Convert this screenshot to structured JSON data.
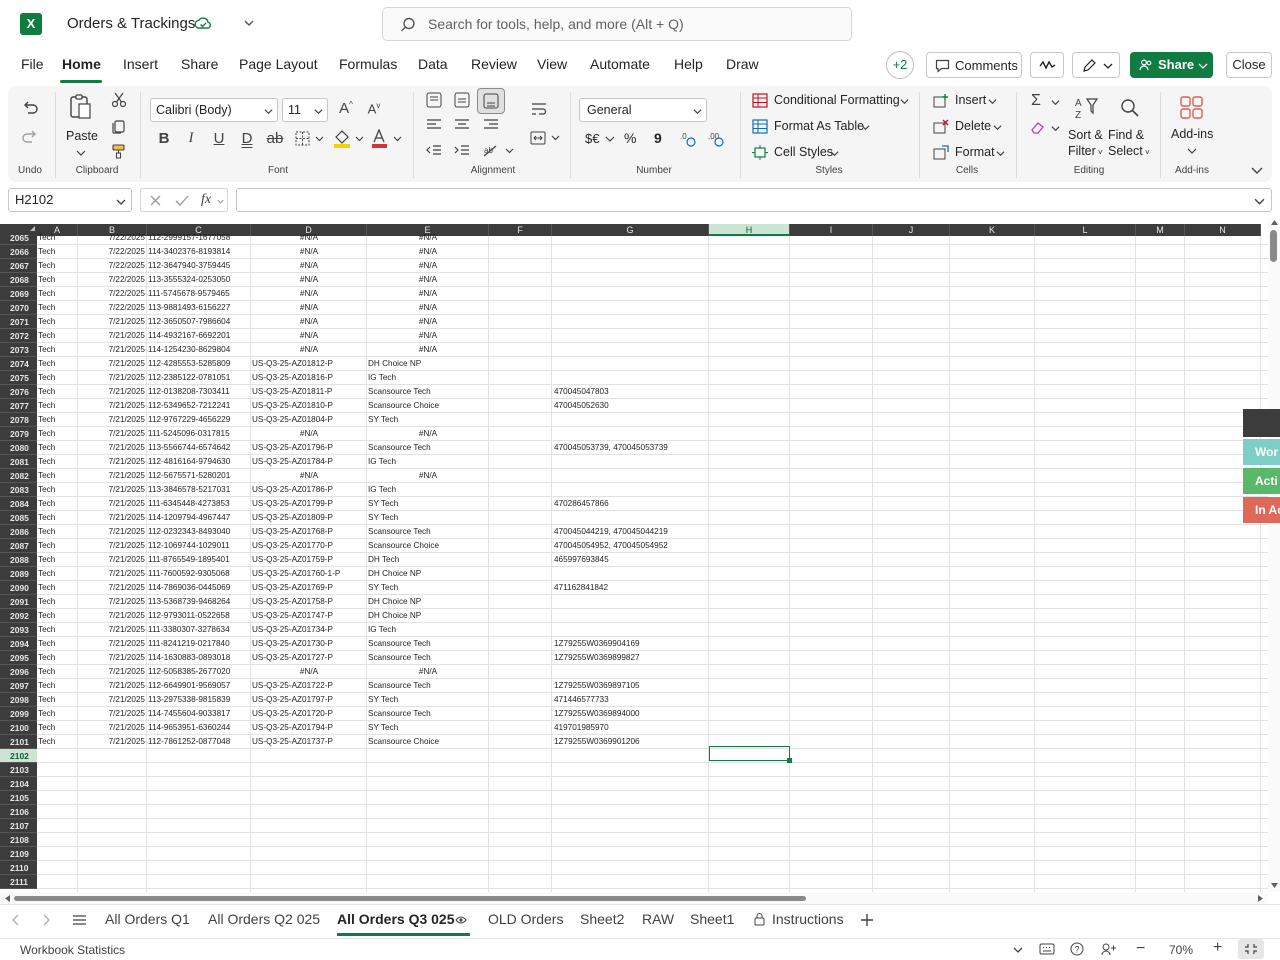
{
  "titlebar": {
    "app_icon": "X",
    "doc_title": "Orders & Trackings",
    "search_placeholder": "Search for tools, help, and more (Alt + Q)"
  },
  "menu": {
    "items": [
      "File",
      "Home",
      "Insert",
      "Share",
      "Page Layout",
      "Formulas",
      "Data",
      "Review",
      "View",
      "Automate",
      "Help",
      "Draw"
    ],
    "active": "Home",
    "collab_count": "+2",
    "comments": "Comments",
    "share": "Share",
    "close": "Close"
  },
  "ribbon": {
    "undo_group": "Undo",
    "clipboard": {
      "paste": "Paste",
      "label": "Clipboard"
    },
    "font": {
      "name": "Calibri (Body)",
      "size": "11",
      "label": "Font"
    },
    "alignment_label": "Alignment",
    "number": {
      "format": "General",
      "currency": "$€",
      "percent": "%",
      "comma": "9",
      "label": "Number"
    },
    "styles": {
      "conditional": "Conditional Formatting",
      "table": "Format As Table",
      "cell": "Cell Styles",
      "label": "Styles"
    },
    "cells": {
      "insert": "Insert",
      "delete": "Delete",
      "format": "Format",
      "label": "Cells"
    },
    "editing": {
      "sort1": "Sort &",
      "sort2": "Filter",
      "find1": "Find &",
      "find2": "Select",
      "label": "Editing"
    },
    "addins": {
      "btn": "Add-ins",
      "label": "Add-ins"
    }
  },
  "formula_bar": {
    "name_box": "H2102",
    "formula": ""
  },
  "grid": {
    "columns": [
      "A",
      "B",
      "C",
      "D",
      "E",
      "F",
      "G",
      "H",
      "I",
      "J",
      "K",
      "L",
      "M",
      "N"
    ],
    "selected_column": "H",
    "selected_row": "2102",
    "partial_row": {
      "num": "2065",
      "a": "Tech",
      "b": "7/22/2025",
      "c": "112-2999157-1677058",
      "d": "#N/A",
      "e": "#N/A"
    },
    "rows": [
      {
        "num": "2066",
        "a": "Tech",
        "b": "7/22/2025",
        "c": "114-3402376-8193814",
        "d": "#N/A",
        "e": "#N/A",
        "g": ""
      },
      {
        "num": "2067",
        "a": "Tech",
        "b": "7/22/2025",
        "c": "112-3647940-3759445",
        "d": "#N/A",
        "e": "#N/A",
        "g": ""
      },
      {
        "num": "2068",
        "a": "Tech",
        "b": "7/22/2025",
        "c": "113-3555324-0253050",
        "d": "#N/A",
        "e": "#N/A",
        "g": ""
      },
      {
        "num": "2069",
        "a": "Tech",
        "b": "7/22/2025",
        "c": "111-5745678-9579465",
        "d": "#N/A",
        "e": "#N/A",
        "g": ""
      },
      {
        "num": "2070",
        "a": "Tech",
        "b": "7/22/2025",
        "c": "113-9881493-6156227",
        "d": "#N/A",
        "e": "#N/A",
        "g": ""
      },
      {
        "num": "2071",
        "a": "Tech",
        "b": "7/21/2025",
        "c": "112-3650507-7986604",
        "d": "#N/A",
        "e": "#N/A",
        "g": ""
      },
      {
        "num": "2072",
        "a": "Tech",
        "b": "7/21/2025",
        "c": "114-4932167-6692201",
        "d": "#N/A",
        "e": "#N/A",
        "g": ""
      },
      {
        "num": "2073",
        "a": "Tech",
        "b": "7/21/2025",
        "c": "114-1254230-8629804",
        "d": "#N/A",
        "e": "#N/A",
        "g": ""
      },
      {
        "num": "2074",
        "a": "Tech",
        "b": "7/21/2025",
        "c": "112-4285553-5285809",
        "d": "US-Q3-25-AZ01812-P",
        "e": "DH Choice NP",
        "g": ""
      },
      {
        "num": "2075",
        "a": "Tech",
        "b": "7/21/2025",
        "c": "112-2385122-0781051",
        "d": "US-Q3-25-AZ01816-P",
        "e": "IG Tech",
        "g": ""
      },
      {
        "num": "2076",
        "a": "Tech",
        "b": "7/21/2025",
        "c": "112-0138208-7303411",
        "d": "US-Q3-25-AZ01811-P",
        "e": "Scansource Tech",
        "g": "470045047803"
      },
      {
        "num": "2077",
        "a": "Tech",
        "b": "7/21/2025",
        "c": "112-5349652-7212241",
        "d": "US-Q3-25-AZ01810-P",
        "e": "Scansource Choice",
        "g": "470045052630"
      },
      {
        "num": "2078",
        "a": "Tech",
        "b": "7/21/2025",
        "c": "112-9767229-4656229",
        "d": "US-Q3-25-AZ01804-P",
        "e": "SY Tech",
        "g": ""
      },
      {
        "num": "2079",
        "a": "Tech",
        "b": "7/21/2025",
        "c": "111-5245096-0317815",
        "d": "#N/A",
        "e": "#N/A",
        "g": ""
      },
      {
        "num": "2080",
        "a": "Tech",
        "b": "7/21/2025",
        "c": "113-5566744-6574642",
        "d": "US-Q3-25-AZ01796-P",
        "e": "Scansource Tech",
        "g": "470045053739, 470045053739"
      },
      {
        "num": "2081",
        "a": "Tech",
        "b": "7/21/2025",
        "c": "112-4816164-9794630",
        "d": "US-Q3-25-AZ01784-P",
        "e": "IG Tech",
        "g": ""
      },
      {
        "num": "2082",
        "a": "Tech",
        "b": "7/21/2025",
        "c": "112-5675571-5280201",
        "d": "#N/A",
        "e": "#N/A",
        "g": ""
      },
      {
        "num": "2083",
        "a": "Tech",
        "b": "7/21/2025",
        "c": "113-3846578-5217031",
        "d": "US-Q3-25-AZ01786-P",
        "e": "IG Tech",
        "g": ""
      },
      {
        "num": "2084",
        "a": "Tech",
        "b": "7/21/2025",
        "c": "111-6345448-4273853",
        "d": "US-Q3-25-AZ01799-P",
        "e": "SY Tech",
        "g": "470286457866"
      },
      {
        "num": "2085",
        "a": "Tech",
        "b": "7/21/2025",
        "c": "114-1209794-4967447",
        "d": "US-Q3-25-AZ01809-P",
        "e": "SY Tech",
        "g": ""
      },
      {
        "num": "2086",
        "a": "Tech",
        "b": "7/21/2025",
        "c": "112-0232343-8493040",
        "d": "US-Q3-25-AZ01768-P",
        "e": "Scansource Tech",
        "g": "470045044219, 470045044219"
      },
      {
        "num": "2087",
        "a": "Tech",
        "b": "7/21/2025",
        "c": "112-1069744-1029011",
        "d": "US-Q3-25-AZ01770-P",
        "e": "Scansource Choice",
        "g": "470045054952, 470045054952"
      },
      {
        "num": "2088",
        "a": "Tech",
        "b": "7/21/2025",
        "c": "111-8765549-1895401",
        "d": "US-Q3-25-AZ01759-P",
        "e": "DH Tech",
        "g": "465997693845"
      },
      {
        "num": "2089",
        "a": "Tech",
        "b": "7/21/2025",
        "c": "111-7600592-9305068",
        "d": "US-Q3-25-AZ01760-1-P",
        "e": "DH Choice NP",
        "g": ""
      },
      {
        "num": "2090",
        "a": "Tech",
        "b": "7/21/2025",
        "c": "114-7869036-0445069",
        "d": "US-Q3-25-AZ01769-P",
        "e": "SY Tech",
        "g": "471162841842"
      },
      {
        "num": "2091",
        "a": "Tech",
        "b": "7/21/2025",
        "c": "113-5368739-9468264",
        "d": "US-Q3-25-AZ01758-P",
        "e": "DH Choice NP",
        "g": ""
      },
      {
        "num": "2092",
        "a": "Tech",
        "b": "7/21/2025",
        "c": "112-9793011-0522658",
        "d": "US-Q3-25-AZ01747-P",
        "e": "DH Choice NP",
        "g": ""
      },
      {
        "num": "2093",
        "a": "Tech",
        "b": "7/21/2025",
        "c": "111-3380307-3278634",
        "d": "US-Q3-25-AZ01734-P",
        "e": "IG Tech",
        "g": ""
      },
      {
        "num": "2094",
        "a": "Tech",
        "b": "7/21/2025",
        "c": "111-8241219-0217840",
        "d": "US-Q3-25-AZ01730-P",
        "e": "Scansource Tech",
        "g": "1Z79255W0369904169"
      },
      {
        "num": "2095",
        "a": "Tech",
        "b": "7/21/2025",
        "c": "114-1630883-0893018",
        "d": "US-Q3-25-AZ01727-P",
        "e": "Scansource Tech",
        "g": "1Z79255W0369899827"
      },
      {
        "num": "2096",
        "a": "Tech",
        "b": "7/21/2025",
        "c": "112-5058385-2677020",
        "d": "#N/A",
        "e": "#N/A",
        "g": ""
      },
      {
        "num": "2097",
        "a": "Tech",
        "b": "7/21/2025",
        "c": "112-6649901-9569057",
        "d": "US-Q3-25-AZ01722-P",
        "e": "Scansource Tech",
        "g": "1Z79255W0369897105"
      },
      {
        "num": "2098",
        "a": "Tech",
        "b": "7/21/2025",
        "c": "113-2975338-9815839",
        "d": "US-Q3-25-AZ01797-P",
        "e": "SY Tech",
        "g": "471446577733"
      },
      {
        "num": "2099",
        "a": "Tech",
        "b": "7/21/2025",
        "c": "114-7455604-9033817",
        "d": "US-Q3-25-AZ01720-P",
        "e": "Scansource Tech",
        "g": "1Z79255W0369894000"
      },
      {
        "num": "2100",
        "a": "Tech",
        "b": "7/21/2025",
        "c": "114-9653951-6360244",
        "d": "US-Q3-25-AZ01794-P",
        "e": "SY Tech",
        "g": "419701985970"
      },
      {
        "num": "2101",
        "a": "Tech",
        "b": "7/21/2025",
        "c": "112-7861252-0877048",
        "d": "US-Q3-25-AZ01737-P",
        "e": "Scansource Choice",
        "g": "1Z79255W0369901206"
      },
      {
        "num": "2102",
        "a": "",
        "b": "",
        "c": "",
        "d": "",
        "e": "",
        "g": ""
      },
      {
        "num": "2103",
        "a": "",
        "b": "",
        "c": "",
        "d": "",
        "e": "",
        "g": ""
      },
      {
        "num": "2104",
        "a": "",
        "b": "",
        "c": "",
        "d": "",
        "e": "",
        "g": ""
      },
      {
        "num": "2105",
        "a": "",
        "b": "",
        "c": "",
        "d": "",
        "e": "",
        "g": ""
      },
      {
        "num": "2106",
        "a": "",
        "b": "",
        "c": "",
        "d": "",
        "e": "",
        "g": ""
      },
      {
        "num": "2107",
        "a": "",
        "b": "",
        "c": "",
        "d": "",
        "e": "",
        "g": ""
      },
      {
        "num": "2108",
        "a": "",
        "b": "",
        "c": "",
        "d": "",
        "e": "",
        "g": ""
      },
      {
        "num": "2109",
        "a": "",
        "b": "",
        "c": "",
        "d": "",
        "e": "",
        "g": ""
      },
      {
        "num": "2110",
        "a": "",
        "b": "",
        "c": "",
        "d": "",
        "e": "",
        "g": ""
      },
      {
        "num": "2111",
        "a": "",
        "b": "",
        "c": "",
        "d": "",
        "e": "",
        "g": ""
      }
    ]
  },
  "side_panel": [
    {
      "label": "Wor",
      "color": "#7dcfc6"
    },
    {
      "label": "Acti",
      "color": "#58b96b"
    },
    {
      "label": "In Ac",
      "color": "#e0685b"
    }
  ],
  "sheet_tabs": {
    "tabs": [
      "All Orders Q1",
      "All Orders Q2 025",
      "All Orders Q3 025",
      "OLD Orders",
      "Sheet2",
      "RAW",
      "Sheet1",
      "Instructions"
    ],
    "active": "All Orders Q3 025"
  },
  "status": {
    "left": "Workbook Statistics",
    "zoom": "70%"
  },
  "colors": {
    "accent": "#107c41",
    "header_dark": "#3c3c3c"
  }
}
